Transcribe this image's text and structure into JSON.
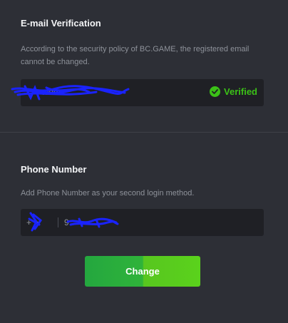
{
  "email_section": {
    "title": "E-mail Verification",
    "description": "According to the security policy of BC.GAME, the registered email cannot be changed.",
    "email_value": ".com",
    "status_label": "Verified",
    "status_icon": "check-circle-icon",
    "status_color": "#3bc117"
  },
  "phone_section": {
    "title": "Phone Number",
    "description": "Add Phone Number as your second login method.",
    "country_code": "+",
    "phone_value": "9",
    "country_icon": "chevron-down-icon"
  },
  "actions": {
    "change_label": "Change"
  },
  "colors": {
    "background": "#2d2f36",
    "field_background": "#1f2025",
    "button_green": "#3bc117",
    "redaction": "#1a23ff"
  }
}
